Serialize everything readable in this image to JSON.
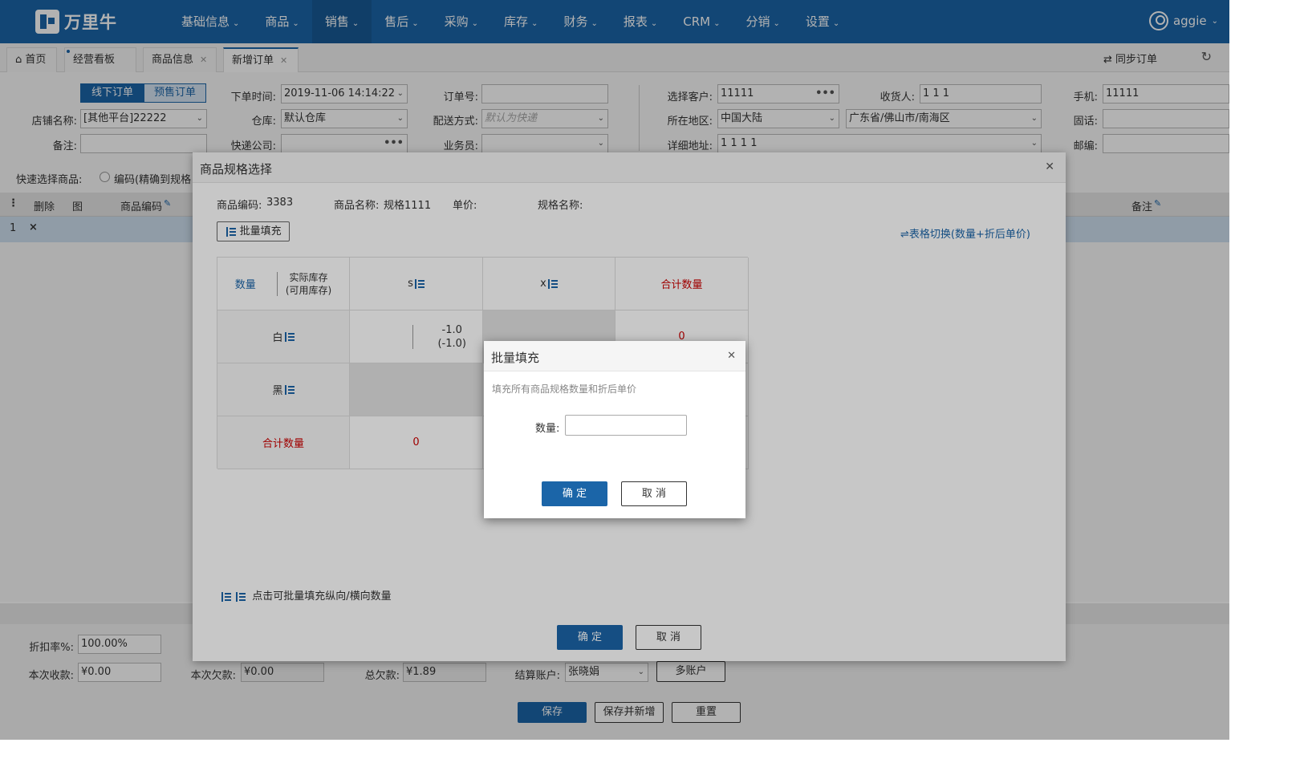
{
  "nav": {
    "logo_text": "万里牛",
    "menu": [
      {
        "label": "基础信息"
      },
      {
        "label": "商品"
      },
      {
        "label": "销售",
        "active": true
      },
      {
        "label": "售后"
      },
      {
        "label": "采购"
      },
      {
        "label": "库存"
      },
      {
        "label": "财务"
      },
      {
        "label": "报表"
      },
      {
        "label": "CRM"
      },
      {
        "label": "分销"
      },
      {
        "label": "设置"
      }
    ],
    "user": "aggie"
  },
  "tabs": {
    "items": [
      {
        "label": "首页"
      },
      {
        "label": "经营看板"
      },
      {
        "label": "商品信息"
      },
      {
        "label": "新增订单",
        "active": true
      }
    ],
    "sync_label": "同步订单"
  },
  "order_form": {
    "order_type_offline": "线下订单",
    "order_type_presale": "预售订单",
    "shop_label": "店铺名称:",
    "shop_value": "[其他平台]22222",
    "remark_label": "备注:",
    "order_time_label": "下单时间:",
    "order_time_value": "2019-11-06 14:14:22",
    "warehouse_label": "仓库:",
    "warehouse_value": "默认仓库",
    "express_label": "快递公司:",
    "order_no_label": "订单号:",
    "delivery_label": "配送方式:",
    "delivery_placeholder": "默认为快递",
    "salesman_label": "业务员:",
    "customer_label": "选择客户:",
    "customer_value": "11111",
    "region_label": "所在地区:",
    "region_value": "中国大陆",
    "region_detail_value": "广东省/佛山市/南海区",
    "address_label": "详细地址:",
    "address_value": "1 1 1 1",
    "receiver_label": "收货人:",
    "receiver_value": "1 1 1",
    "phone_label": "手机:",
    "phone_value": "11111",
    "tel_label": "固话:",
    "zip_label": "邮编:",
    "quick_select_label": "快速选择商品:",
    "quick_select_option": "编码(精确到规格"
  },
  "grid": {
    "headers": {
      "delete": "删除",
      "image": "图",
      "code": "商品编码",
      "remark": "备注"
    },
    "rows": [
      {
        "index": "1",
        "delete": "×"
      }
    ]
  },
  "bottom": {
    "discount_label": "折扣率%:",
    "discount_value": "100.00%",
    "received_label": "本次收款:",
    "received_value": "¥0.00",
    "owed_label": "本次欠款:",
    "owed_value": "¥0.00",
    "total_owed_label": "总欠款:",
    "total_owed_value": "¥1.89",
    "account_label": "结算账户:",
    "account_value": "张晓娟",
    "multi_account": "多账户",
    "save": "保存",
    "save_new": "保存并新增",
    "reset": "重置"
  },
  "spec_modal": {
    "title": "商品规格选择",
    "code_label": "商品编码:",
    "code_value": "3383",
    "name_label": "商品名称:",
    "name_value": "规格1111",
    "price_label": "单价:",
    "spec_label": "规格名称:",
    "batch_fill": "批量填充",
    "switch_table": "表格切换(数量+折后单价)",
    "col_qty": "数量",
    "col_stock": "实际库存\n(可用库存)",
    "col_s": "s",
    "col_x": "x",
    "col_total": "合计数量",
    "row_white": "白",
    "row_black": "黑",
    "row_total": "合计数量",
    "white_stock": "-1.0",
    "white_avail": "(-1.0)",
    "white_total": "0",
    "total_s": "0",
    "hint": "点击可批量填充纵向/横向数量",
    "ok": "确 定",
    "cancel": "取 消"
  },
  "batch_dialog": {
    "title": "批量填充",
    "desc": "填充所有商品规格数量和折后单价",
    "qty_label": "数量:",
    "qty_value": "",
    "ok": "确 定",
    "cancel": "取 消"
  },
  "colors": {
    "primary": "#1b65a8",
    "nav_bg": "#1b65a8",
    "danger": "#cc0000",
    "required": "#f39c12"
  }
}
